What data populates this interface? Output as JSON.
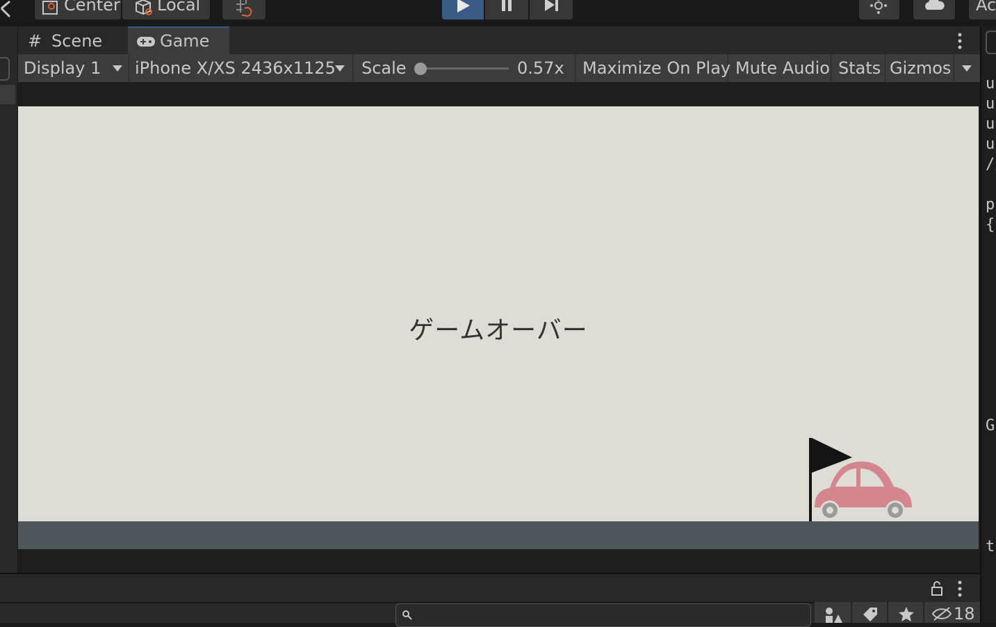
{
  "toolbar": {
    "pivot_label": "Center",
    "space_label": "Local",
    "account_label": "Ac",
    "play_icon": "play-icon",
    "pause_icon": "pause-icon",
    "step_icon": "step-icon"
  },
  "tabs": [
    {
      "label": "Scene",
      "icon": "scene-grid-icon",
      "active": false
    },
    {
      "label": "Game",
      "icon": "gamepad-icon",
      "active": true
    }
  ],
  "game_toolbar": {
    "display": "Display 1",
    "resolution": "iPhone X/XS 2436x1125 L",
    "scale_label": "Scale",
    "scale_value": "0.57x",
    "scale_fraction": 0.0,
    "maximize": "Maximize On Play",
    "mute": "Mute Audio",
    "stats": "Stats",
    "gizmos": "Gizmos"
  },
  "game": {
    "message": "ゲームオーバー",
    "sky_color": "#dfdcd5",
    "ground_color": "#4f575b",
    "car_color": "#d4868f",
    "flag_color": "#141414"
  },
  "side_code": [
    "u",
    "u",
    "u",
    "u",
    "//",
    "",
    "p",
    "{",
    "G",
    "th"
  ],
  "bottom": {
    "hidden_count": "18"
  },
  "colors": {
    "accent": "#3a5b86",
    "panel": "#282828",
    "toolbar": "#3c3c3c"
  }
}
